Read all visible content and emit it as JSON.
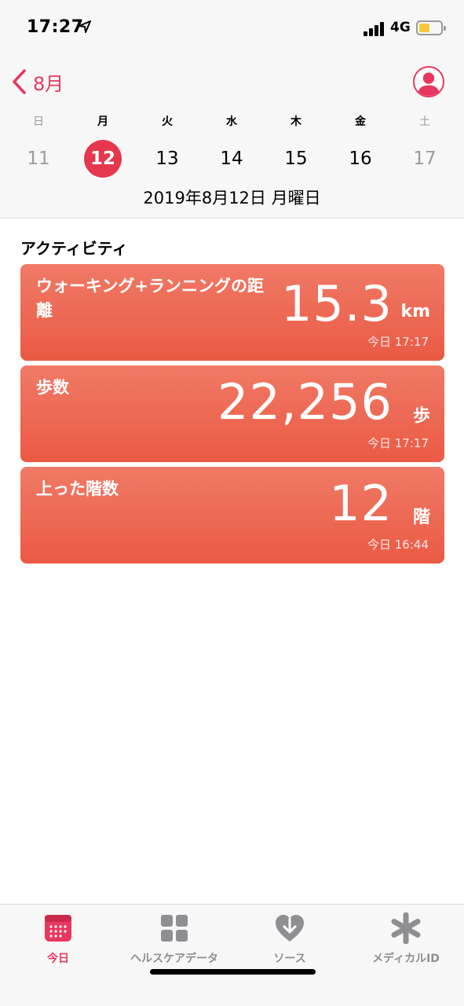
{
  "status": {
    "time": "17:27",
    "network": "4G"
  },
  "header": {
    "back_label": "8月",
    "weekdays": [
      {
        "label": "日",
        "dim": true
      },
      {
        "label": "月",
        "dim": false
      },
      {
        "label": "火",
        "dim": false
      },
      {
        "label": "水",
        "dim": false
      },
      {
        "label": "木",
        "dim": false
      },
      {
        "label": "金",
        "dim": false
      },
      {
        "label": "土",
        "dim": true
      }
    ],
    "dates": [
      {
        "label": "11",
        "dim": true,
        "selected": false
      },
      {
        "label": "12",
        "dim": false,
        "selected": true
      },
      {
        "label": "13",
        "dim": false,
        "selected": false
      },
      {
        "label": "14",
        "dim": false,
        "selected": false
      },
      {
        "label": "15",
        "dim": false,
        "selected": false
      },
      {
        "label": "16",
        "dim": false,
        "selected": false
      },
      {
        "label": "17",
        "dim": true,
        "selected": false
      }
    ],
    "full_date": "2019年8月12日 月曜日"
  },
  "activity": {
    "section_title": "アクティビティ",
    "cards": [
      {
        "title": "ウォーキング+ランニングの距離",
        "value": "15.3",
        "unit": "km",
        "time": "今日 17:17"
      },
      {
        "title": "歩数",
        "value": "22,256",
        "unit": "歩",
        "time": "今日 17:17"
      },
      {
        "title": "上った階数",
        "value": "12",
        "unit": "階",
        "time": "今日 16:44"
      }
    ]
  },
  "tabbar": {
    "tabs": [
      {
        "label": "今日",
        "icon": "calendar-icon",
        "active": true
      },
      {
        "label": "ヘルスケアデータ",
        "icon": "grid-icon",
        "active": false
      },
      {
        "label": "ソース",
        "icon": "heart-download-icon",
        "active": false
      },
      {
        "label": "メディカルID",
        "icon": "asterisk-icon",
        "active": false
      }
    ]
  },
  "colors": {
    "accent": "#e8375e",
    "card": "#ee6b55",
    "inactive": "#8e8e93"
  }
}
